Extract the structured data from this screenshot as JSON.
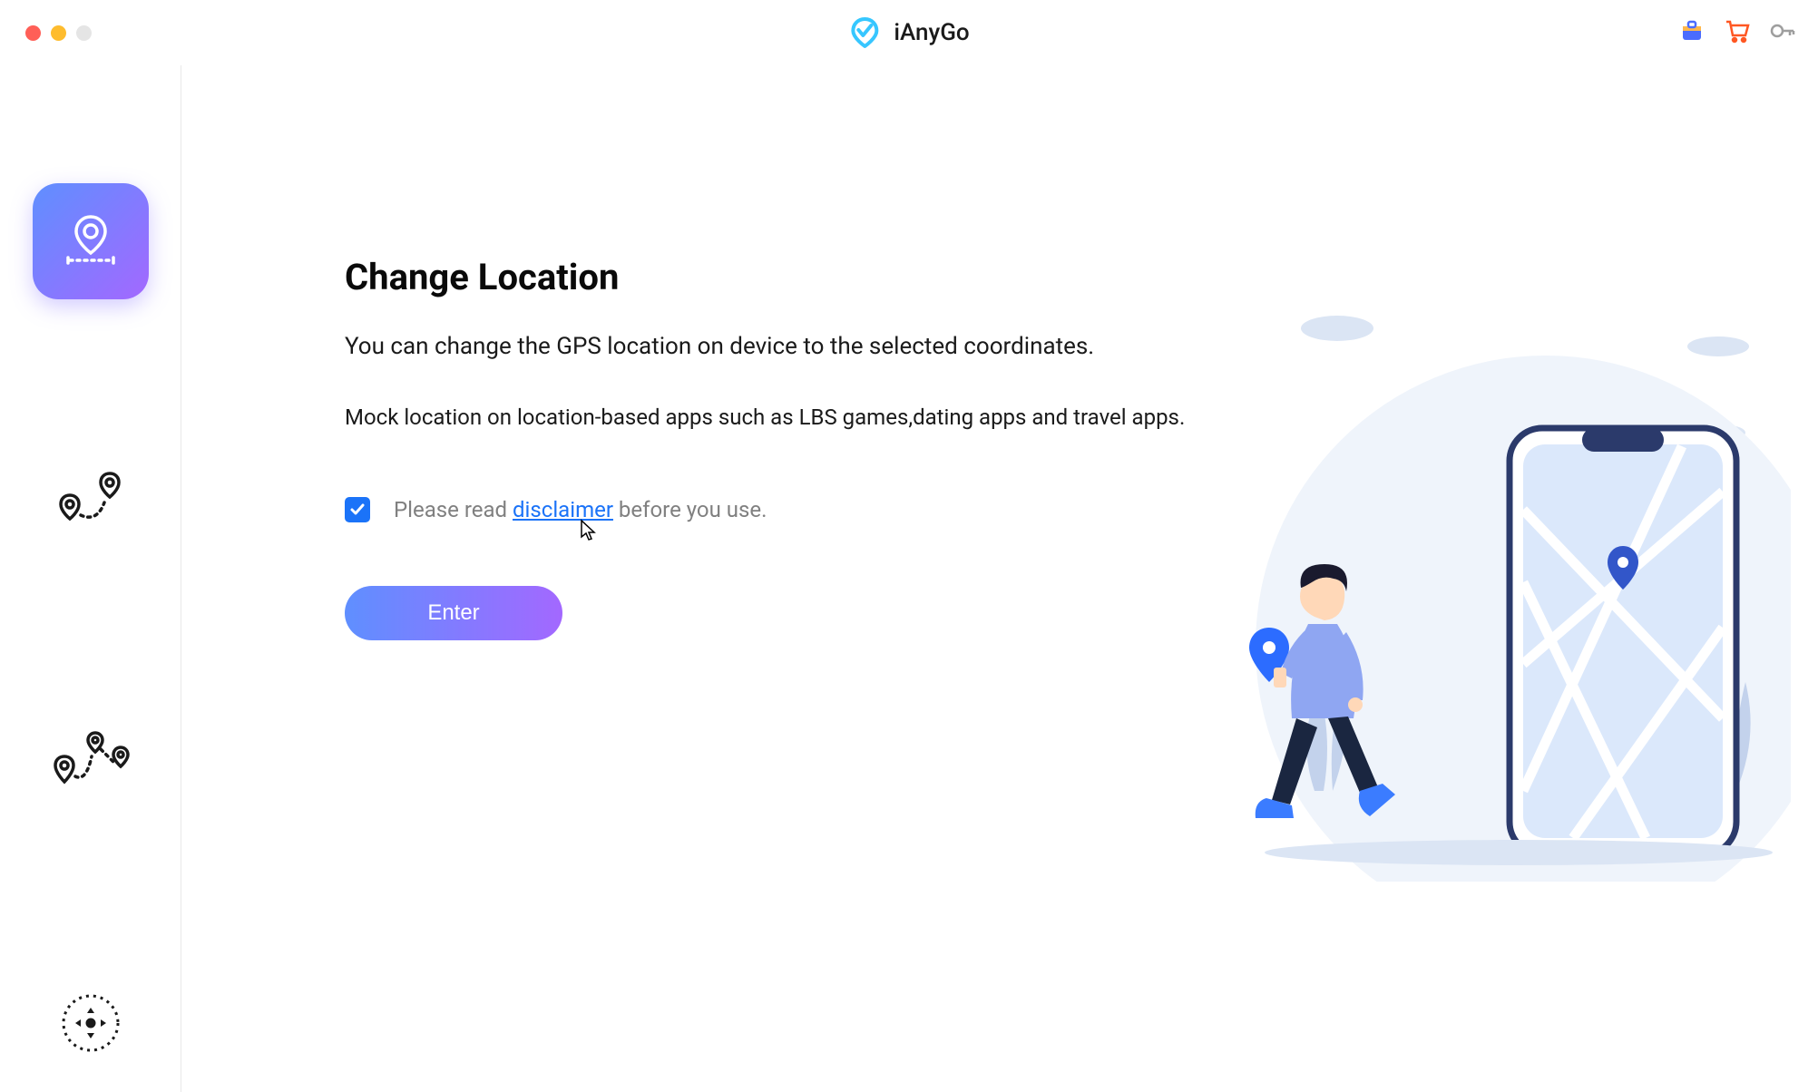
{
  "app": {
    "name": "iAnyGo"
  },
  "titlebar": {
    "icons": {
      "bag": "bag-icon",
      "cart": "cart-icon",
      "key": "key-icon"
    }
  },
  "sidebar": {
    "items": [
      {
        "id": "change-location",
        "active": true
      },
      {
        "id": "single-spot",
        "active": false
      },
      {
        "id": "multi-spot",
        "active": false
      },
      {
        "id": "joystick",
        "active": false
      }
    ]
  },
  "main": {
    "heading": "Change Location",
    "subtitle": "You can change the GPS location on device to the selected coordinates.",
    "description": "Mock location on location-based apps such as LBS games,dating apps and travel apps.",
    "disclaimer_prefix": "Please read ",
    "disclaimer_link": "disclaimer",
    "disclaimer_suffix": " before you use.",
    "enter_label": "Enter",
    "checkbox_checked": true
  }
}
